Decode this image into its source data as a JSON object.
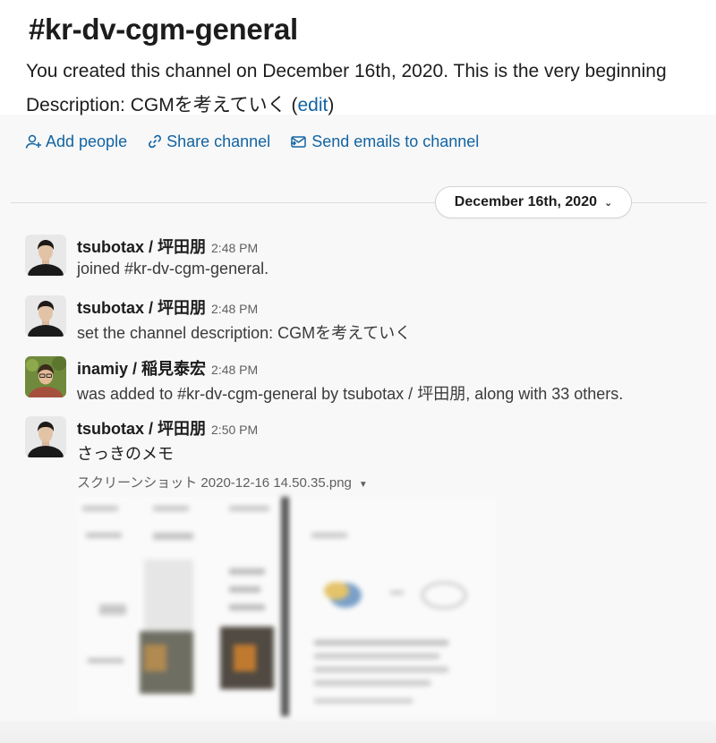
{
  "channel": {
    "title": "#kr-dv-cgm-general",
    "created_line": "You created this channel on December 16th, 2020. This is the very beginning",
    "description_prefix": "Description: CGMを考えていく (",
    "edit_label": "edit",
    "description_suffix": ")"
  },
  "actions": [
    {
      "label": "Add people",
      "icon": "add-person-icon"
    },
    {
      "label": "Share channel",
      "icon": "link-icon"
    },
    {
      "label": "Send emails to channel",
      "icon": "email-forward-icon"
    }
  ],
  "date_divider": {
    "label": "December 16th, 2020",
    "icon": "chevron-down-icon"
  },
  "messages": [
    {
      "sender": "tsubotax / 坪田朋",
      "time": "2:48 PM",
      "text": "joined #kr-dv-cgm-general."
    },
    {
      "sender": "tsubotax / 坪田朋",
      "time": "2:48 PM",
      "text": "set the channel description: CGMを考えていく"
    },
    {
      "sender": "inamiy / 稲見泰宏",
      "time": "2:48 PM",
      "text": "was added to #kr-dv-cgm-general by tsubotax / 坪田朋, along with 33 others."
    },
    {
      "sender": "tsubotax / 坪田朋",
      "time": "2:50 PM",
      "text": "さっきのメモ"
    }
  ],
  "attachment": {
    "file_name": "スクリーンショット 2020-12-16 14.50.35.png",
    "dropdown_icon": "caret-down-icon"
  },
  "colors": {
    "link": "#1264a3",
    "text": "#1d1c1d",
    "muted": "#616061",
    "background": "#f8f8f8"
  }
}
